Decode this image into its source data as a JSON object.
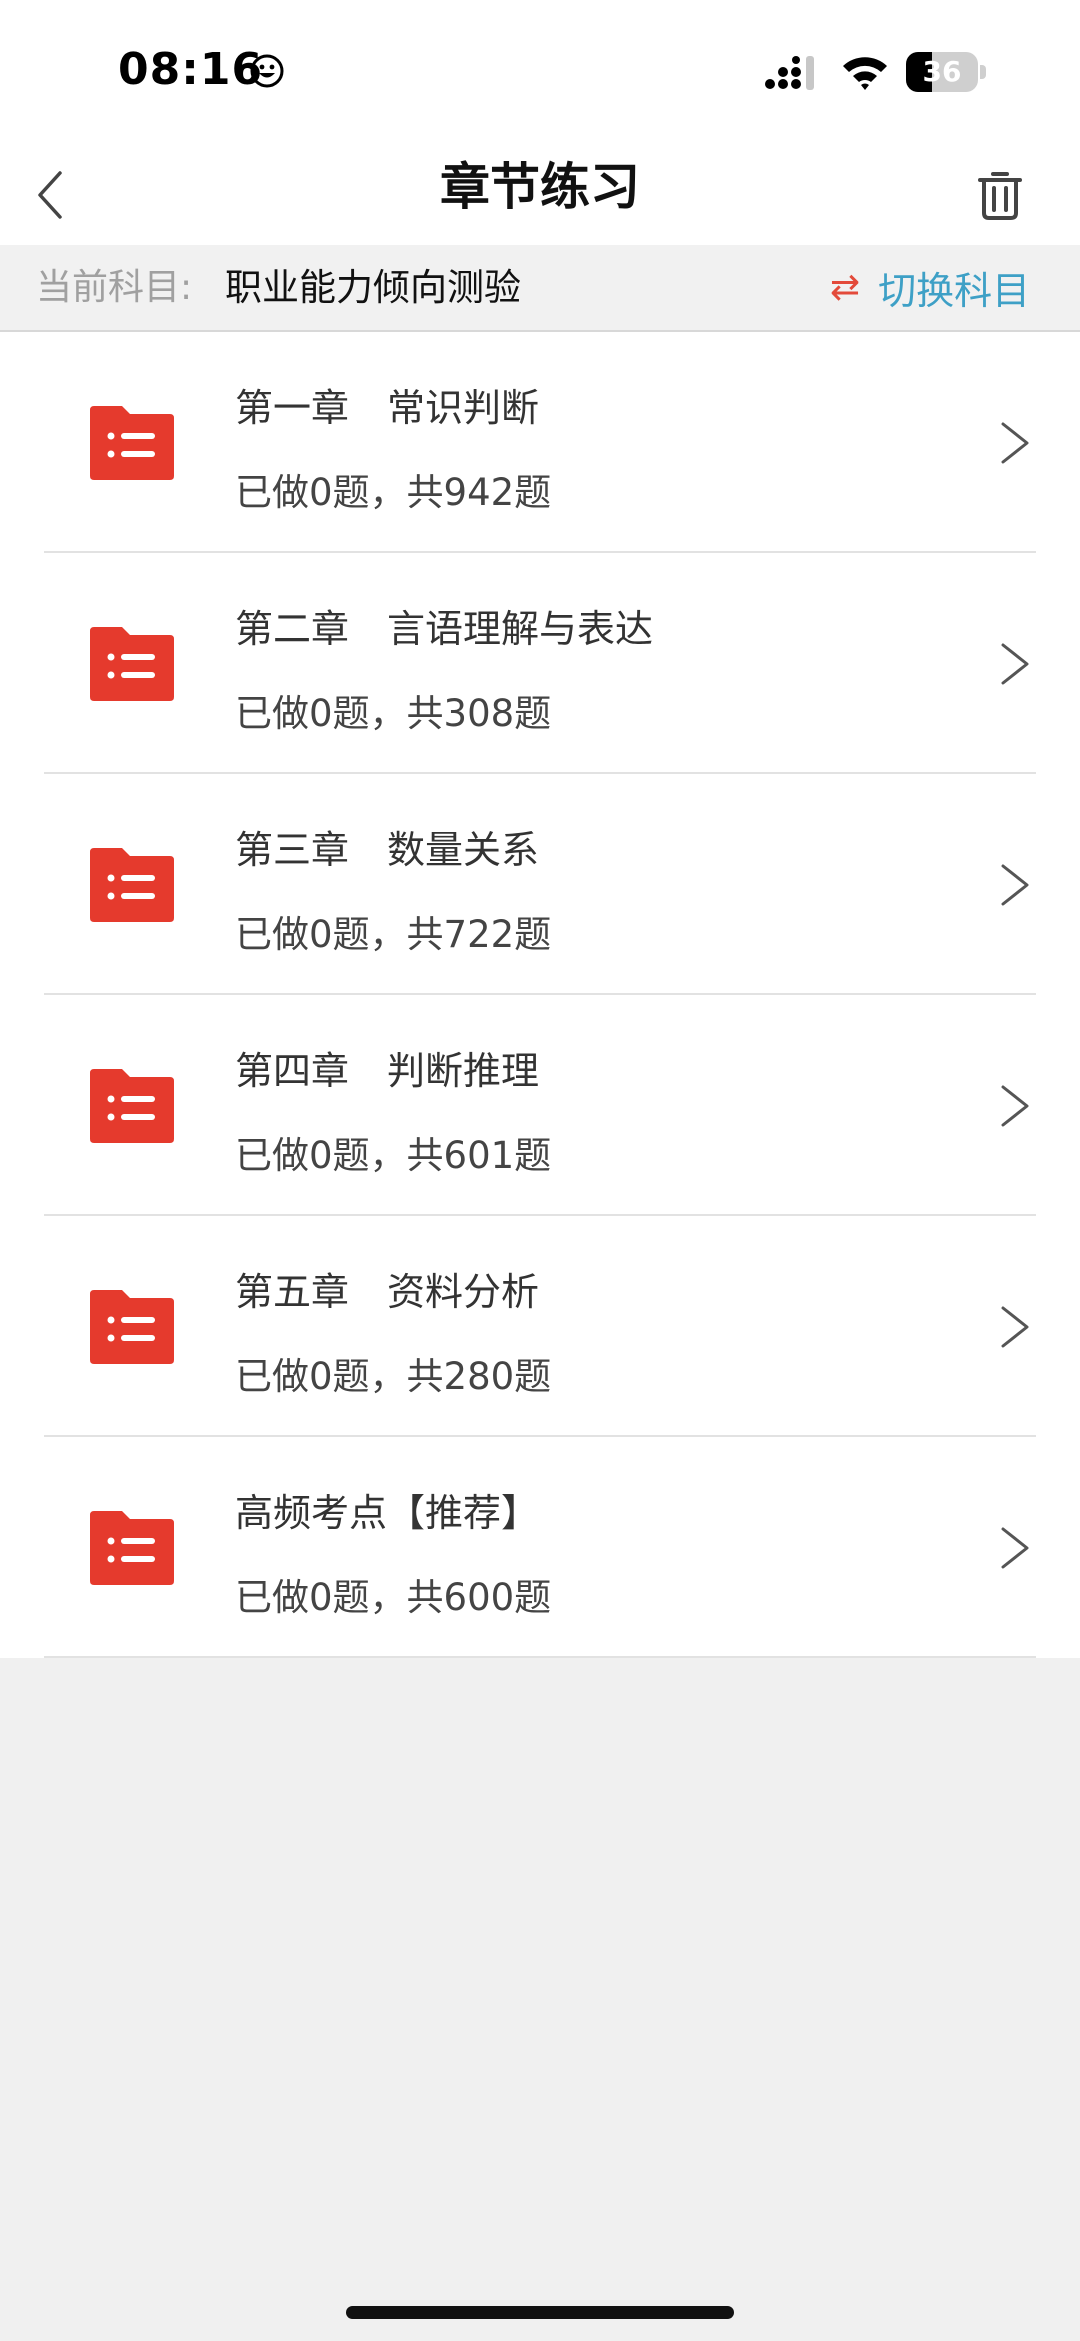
{
  "status_bar": {
    "time": "08:16",
    "battery_level": "36",
    "battery_fraction": 0.36
  },
  "nav": {
    "title": "章节练习",
    "back_icon": "chevron-left-icon",
    "trash_icon": "trash-icon"
  },
  "subject": {
    "label": "当前科目:",
    "value": "职业能力倾向测验",
    "switch_icon": "swap-arrows-icon",
    "switch_label": "切换科目"
  },
  "chapters": [
    {
      "title": "第一章　常识判断",
      "progress": "已做0题，共942题"
    },
    {
      "title": "第二章　言语理解与表达",
      "progress": "已做0题，共308题"
    },
    {
      "title": "第三章　数量关系",
      "progress": "已做0题，共722题"
    },
    {
      "title": "第四章　判断推理",
      "progress": "已做0题，共601题"
    },
    {
      "title": "第五章　资料分析",
      "progress": "已做0题，共280题"
    },
    {
      "title": "高频考点【推荐】",
      "progress": "已做0题，共600题"
    }
  ],
  "colors": {
    "folder": "#e53a2d",
    "accent_blue": "#3ea0c6",
    "accent_red": "#e34a3a"
  }
}
